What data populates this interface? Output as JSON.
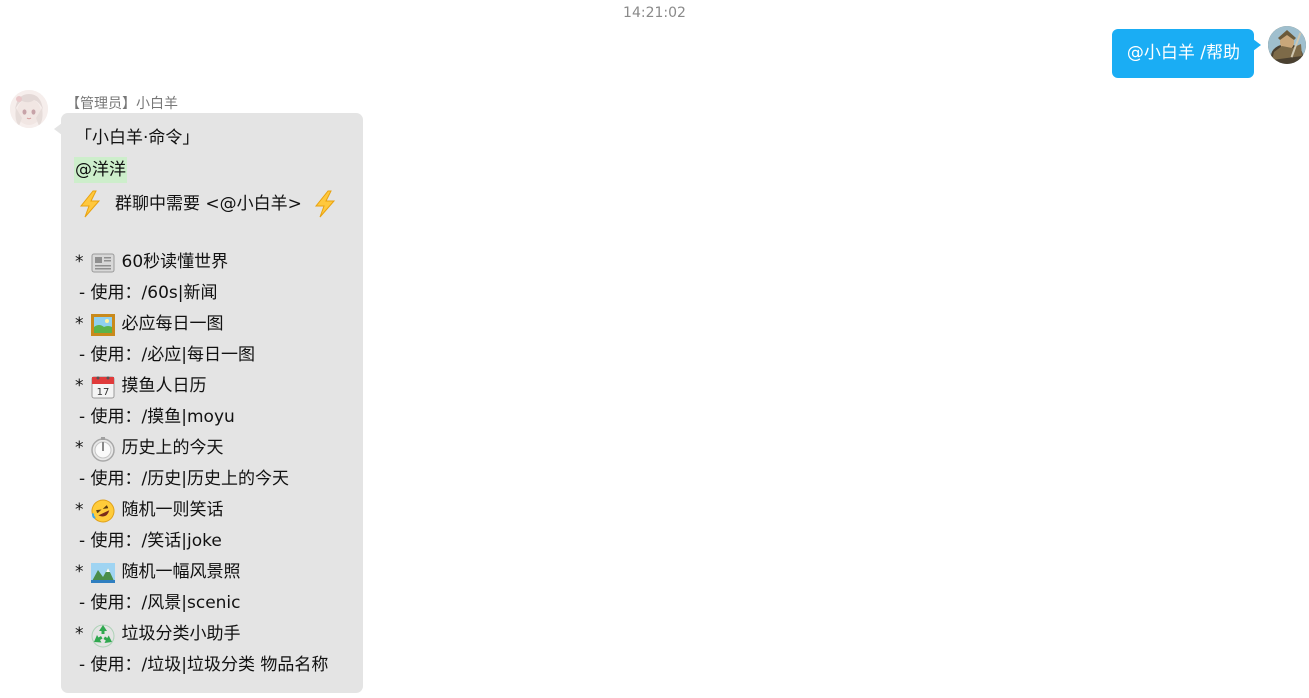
{
  "timestamp": "14:21:02",
  "outgoing": {
    "avatar_icon": "warrior-avatar",
    "text": "@小白羊 /帮助"
  },
  "incoming": {
    "avatar_icon": "anime-girl-avatar",
    "sender": "【管理员】小白羊",
    "title": "「小白羊·命令」",
    "mention": "@洋洋",
    "notice": "群聊中需要 <@小白羊>",
    "notice_icon": "lightning-icon",
    "commands": [
      {
        "bullet": "*",
        "icon": "newspaper-icon",
        "name": "60秒读懂世界",
        "usage": "- 使用：/60s|新闻"
      },
      {
        "bullet": "*",
        "icon": "framed-picture-icon",
        "name": "必应每日一图",
        "usage": "- 使用：/必应|每日一图"
      },
      {
        "bullet": "*",
        "icon": "calendar-icon",
        "name": "摸鱼人日历",
        "usage": "- 使用：/摸鱼|moyu"
      },
      {
        "bullet": "*",
        "icon": "stopwatch-icon",
        "name": "历史上的今天",
        "usage": "- 使用：/历史|历史上的今天"
      },
      {
        "bullet": "*",
        "icon": "rofl-face-icon",
        "name": "随机一则笑话",
        "usage": "- 使用：/笑话|joke"
      },
      {
        "bullet": "*",
        "icon": "landscape-icon",
        "name": "随机一幅风景照",
        "usage": "- 使用：/风景|scenic"
      },
      {
        "bullet": "*",
        "icon": "recycle-icon",
        "name": "垃圾分类小助手",
        "usage": "- 使用：/垃圾|垃圾分类 物品名称"
      }
    ]
  },
  "colors": {
    "outgoing_bubble": "#1aadf4",
    "incoming_bubble": "#e4e4e4",
    "mention_highlight": "#cdeecb"
  }
}
